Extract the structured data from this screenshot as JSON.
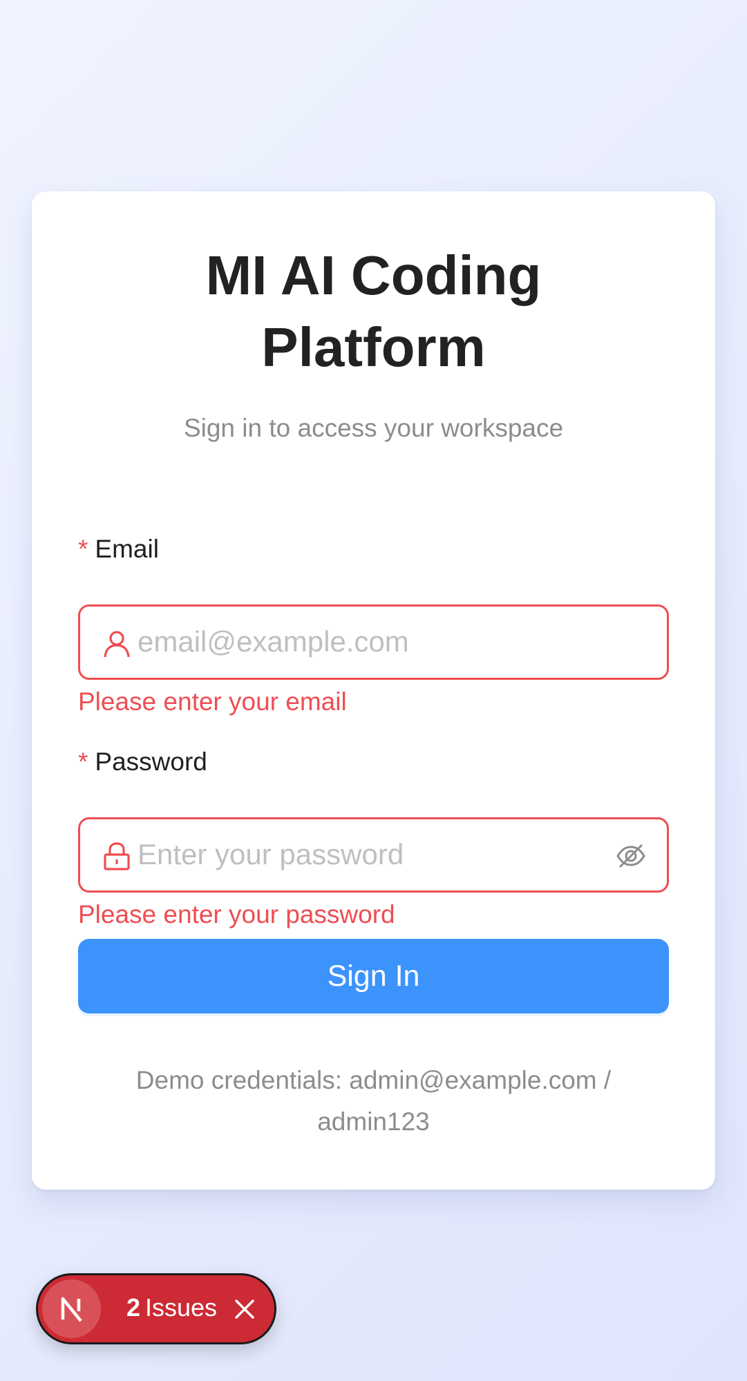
{
  "login": {
    "title_line1": "MI AI Coding",
    "title_line2": "Platform",
    "subtitle": "Sign in to access your workspace",
    "email": {
      "required_mark": "*",
      "label": "Email",
      "placeholder": "email@example.com",
      "value": "",
      "icon": "user-icon",
      "error": "Please enter your email"
    },
    "password": {
      "required_mark": "*",
      "label": "Password",
      "placeholder": "Enter your password",
      "value": "",
      "icon": "lock-icon",
      "toggle_icon": "eye-invisible-icon",
      "error": "Please enter your password"
    },
    "submit_label": "Sign In",
    "demo_line1": "Demo credentials: admin@example.com /",
    "demo_line2": "admin123"
  },
  "dev_overlay": {
    "badge_letter": "N",
    "issue_count": "2",
    "issue_label": "Issues",
    "close_icon": "close-icon"
  },
  "colors": {
    "primary": "#3d93fc",
    "error": "#ef4d52",
    "overlay_red": "#cc2a34"
  }
}
